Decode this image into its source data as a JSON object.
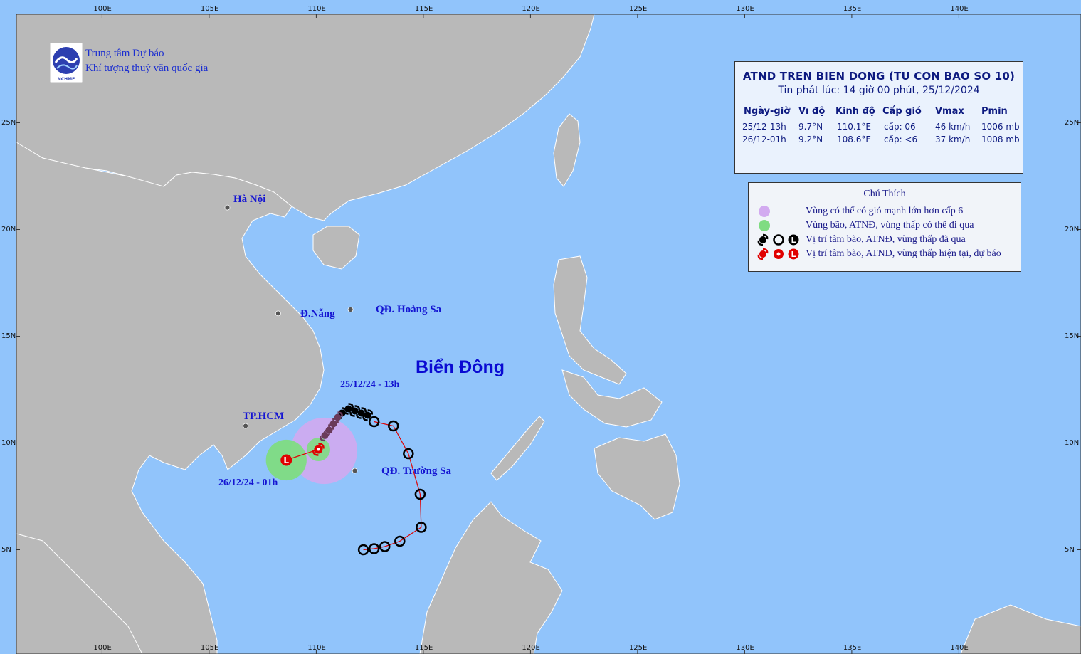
{
  "organization": {
    "line1": "Trung tâm Dự báo",
    "line2": "Khí tượng thuỷ văn quốc gia",
    "logo_text": "NCHMF"
  },
  "info_box": {
    "title": "ATND TREN BIEN DONG (TU CON BAO SO 10)",
    "issued": "Tin phát lúc: 14 giờ 00 phút, 25/12/2024",
    "columns": [
      "Ngày-giờ",
      "Vĩ độ",
      "Kinh độ",
      "Cấp gió",
      "Vmax",
      "Pmin"
    ],
    "rows": [
      {
        "time": "25/12-13h",
        "lat": "9.7°N",
        "lon": "110.1°E",
        "wind": "cấp: 06",
        "vmax": "46 km/h",
        "pmin": "1006 mb"
      },
      {
        "time": "26/12-01h",
        "lat": "9.2°N",
        "lon": "108.6°E",
        "wind": "cấp: <6",
        "vmax": "37 km/h",
        "pmin": "1008 mb"
      }
    ]
  },
  "legend": {
    "title": "Chú Thích",
    "items": [
      {
        "label": "Vùng có thể có gió mạnh lớn hơn cấp 6",
        "color": "#d2aaf0"
      },
      {
        "label": "Vùng bão, ATNĐ, vùng thấp có thể đi qua",
        "color": "#7fdc82"
      },
      {
        "label": "Vị trí tâm bão, ATNĐ, vùng thấp đã qua",
        "color": "#000000"
      },
      {
        "label": "Vị trí tâm bão, ATNĐ, vùng thấp hiện tại, dự báo",
        "color": "#e00000"
      }
    ]
  },
  "places": {
    "hanoi": "Hà Nội",
    "danang": "Đ.Nẵng",
    "hoangsa": "QĐ. Hoàng Sa",
    "hcm": "TP.HCM",
    "truongsa": "QĐ. Trường Sa",
    "sea": "Biển Đông"
  },
  "date_labels": {
    "current": "25/12/24 - 13h",
    "forecast": "26/12/24 - 01h"
  },
  "axes": {
    "lon_ticks": [
      "100E",
      "105E",
      "110E",
      "115E",
      "120E",
      "125E",
      "130E",
      "135E",
      "140E"
    ],
    "lat_ticks": [
      "25N",
      "20N",
      "15N",
      "10N",
      "5N"
    ]
  },
  "colors": {
    "sea": "#91c4fb",
    "land": "#b9b9b9",
    "land_border": "#ffffff",
    "track": "#e00000",
    "past_marker": "#000000"
  },
  "track": {
    "past_positions": [
      {
        "lon": 112.2,
        "lat": 5.0
      },
      {
        "lon": 112.7,
        "lat": 5.05
      },
      {
        "lon": 113.2,
        "lat": 5.15
      },
      {
        "lon": 113.9,
        "lat": 5.4
      },
      {
        "lon": 114.9,
        "lat": 6.05
      },
      {
        "lon": 114.85,
        "lat": 7.6
      },
      {
        "lon": 114.3,
        "lat": 9.5
      },
      {
        "lon": 113.6,
        "lat": 10.8
      },
      {
        "lon": 112.7,
        "lat": 11.0
      }
    ],
    "cluster_positions": [
      {
        "lon": 111.5,
        "lat": 11.6
      },
      {
        "lon": 111.8,
        "lat": 11.5
      },
      {
        "lon": 112.1,
        "lat": 11.4
      },
      {
        "lon": 112.4,
        "lat": 11.3
      },
      {
        "lon": 111.2,
        "lat": 11.4
      },
      {
        "lon": 111.0,
        "lat": 11.2
      },
      {
        "lon": 110.8,
        "lat": 10.9
      },
      {
        "lon": 110.6,
        "lat": 10.6
      },
      {
        "lon": 110.4,
        "lat": 10.35
      }
    ],
    "current": {
      "lon": 110.1,
      "lat": 9.7
    },
    "forecast": {
      "lon": 108.6,
      "lat": 9.2
    },
    "wind6_radius_deg": 1.55,
    "danger_radius_deg": 0.95
  }
}
